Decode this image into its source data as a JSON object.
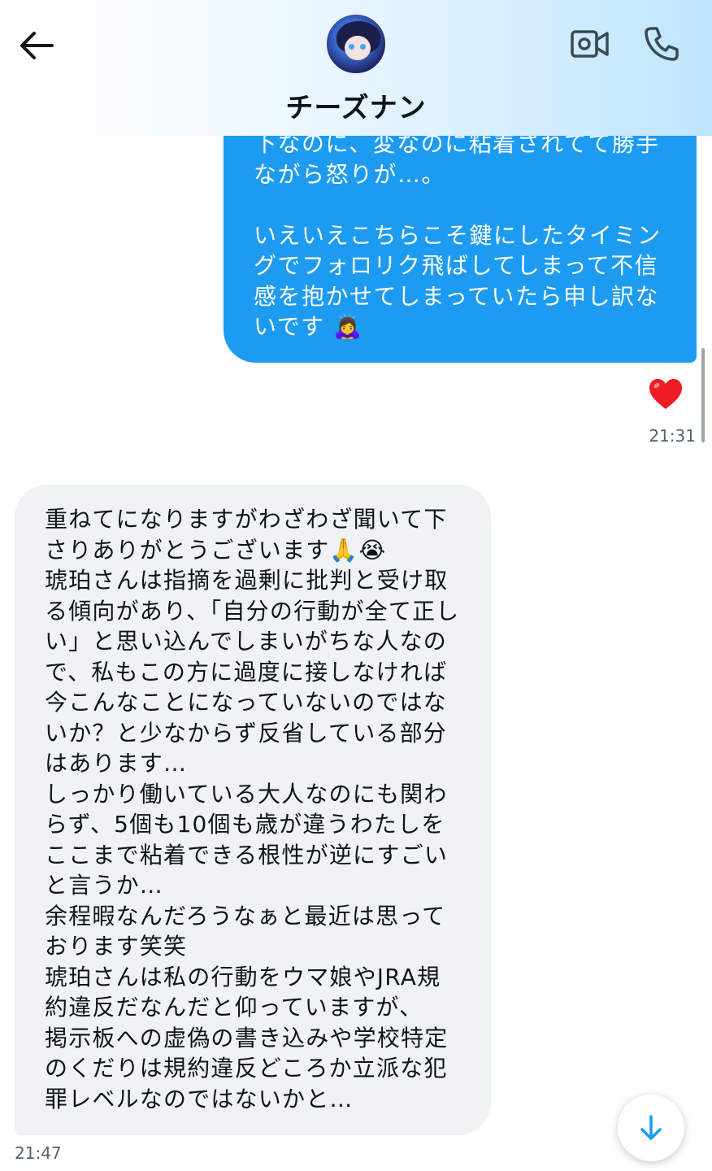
{
  "header": {
    "contact_name": "チーズナン",
    "icons": {
      "back": "arrow-left-icon",
      "video": "video-camera-icon",
      "call": "phone-icon"
    }
  },
  "messages": {
    "sent": {
      "text": "下なのに、変なのに粘着されてて勝手\nながら怒りが…。\n\nいえいえこちらこそ鍵にしたタイミン\nグでフォロリク飛ばしてしまって不信\n感を抱かせてしまっていたら申し訳な\nいです 🙇‍♀️",
      "reaction": "❤️",
      "time": "21:31"
    },
    "received": {
      "text": "重ねてになりますがわざわざ聞いて下\nさりありがとうございます🙏😭\n琥珀さんは指摘を過剰に批判と受け取\nる傾向があり、「自分の行動が全て正し\nい」と思い込んでしまいがちな人なの\nで、私もこの方に過度に接しなければ\n今こんなことになっていないのではな\nいか？と少なからず反省している部分\nはあります…\nしっかり働いている大人なのにも関わ\nらず、5個も10個も歳が違うわたしを\nここまで粘着できる根性が逆にすごい\nと言うか…\n余程暇なんだろうなぁと最近は思って\nおります笑笑\n琥珀さんは私の行動をウマ娘やJRA規\n約違反だなんだと仰っていますが、\n掲示板への虚偽の書き込みや学校特定\nのくだりは規約違反どころか立派な犯\n罪レベルなのではないかと…",
      "time": "21:47"
    }
  },
  "controls": {
    "scroll_down_icon": "arrow-down-icon"
  },
  "colors": {
    "sent_bubble": "#1d9bf0",
    "received_bubble": "#eff3f4",
    "timestamp": "#536471",
    "accent": "#1d9bf0"
  }
}
